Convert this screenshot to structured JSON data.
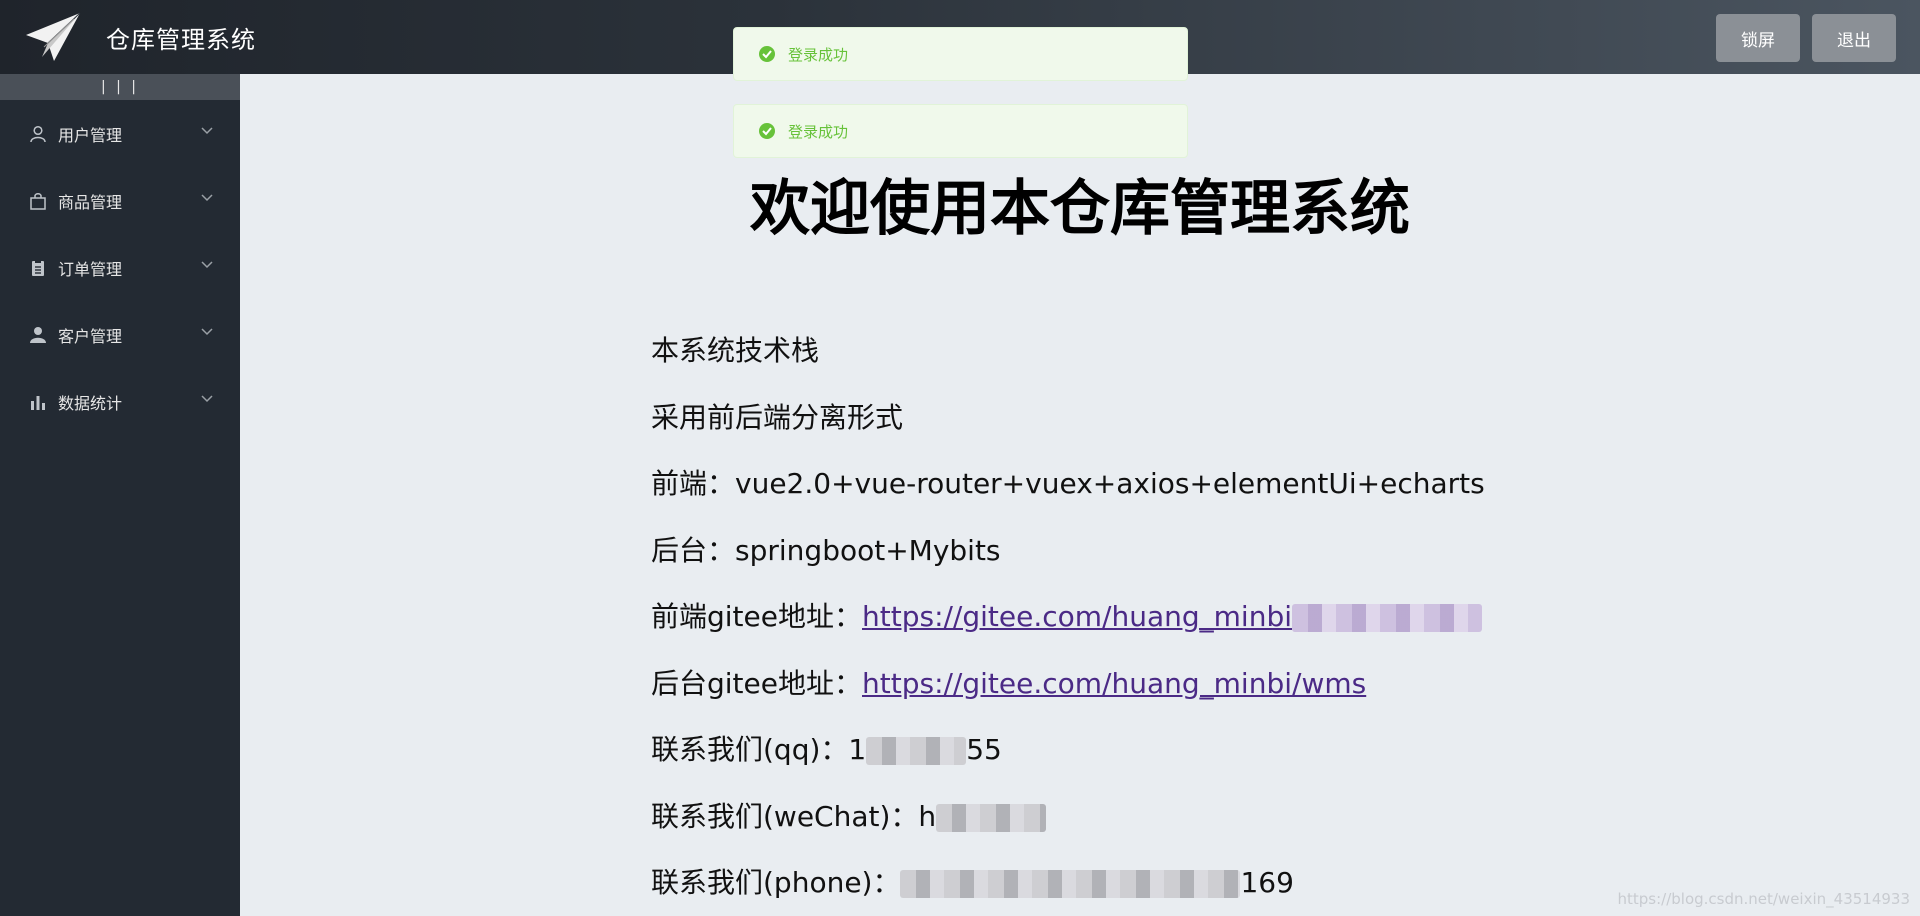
{
  "header": {
    "title": "仓库管理系统",
    "lock_label": "锁屏",
    "logout_label": "退出"
  },
  "sidebar": {
    "collapse_label": "| | |",
    "items": [
      {
        "label": "用户管理",
        "icon": "user-icon"
      },
      {
        "label": "商品管理",
        "icon": "shopping-bag-icon"
      },
      {
        "label": "订单管理",
        "icon": "clipboard-icon"
      },
      {
        "label": "客户管理",
        "icon": "customer-icon"
      },
      {
        "label": "数据统计",
        "icon": "bar-chart-icon"
      }
    ]
  },
  "toasts": [
    {
      "message": "登录成功"
    },
    {
      "message": "登录成功"
    }
  ],
  "main": {
    "title": "欢迎使用本仓库管理系统",
    "stack_heading": "本系统技术栈",
    "mode_line": "采用前后端分离形式",
    "frontend": {
      "label": "前端：",
      "value": "vue2.0+vue-router+vuex+axios+elementUi+echarts"
    },
    "backend": {
      "label": "后台：",
      "value": "springboot+Mybits"
    },
    "frontend_repo": {
      "label": "前端gitee地址：",
      "link": "https://gitee.com/huang_minbi"
    },
    "backend_repo": {
      "label": "后台gitee地址：",
      "link": "https://gitee.com/huang_minbi",
      "tail": "/wms"
    },
    "contact_qq": {
      "label": "联系我们(qq)：",
      "partial": "1",
      "tail": "55"
    },
    "contact_wechat": {
      "label": "联系我们(weChat)：",
      "partial": "h"
    },
    "contact_phone": {
      "label": "联系我们(phone)：",
      "tail": "169"
    }
  },
  "watermark": "https://blog.csdn.net/weixin_43514933",
  "colors": {
    "toast_green": "#67c23a",
    "sidebar_bg": "#232a33",
    "link": "#4b2a86"
  }
}
